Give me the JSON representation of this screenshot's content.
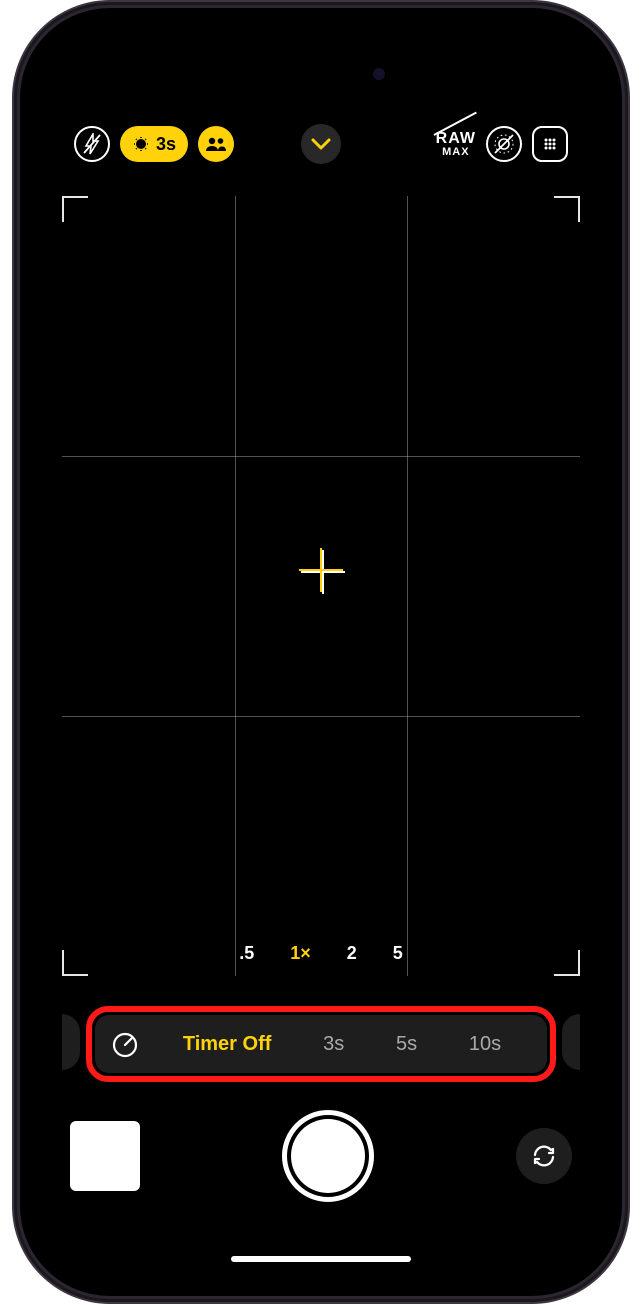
{
  "colors": {
    "accent_yellow": "#ffd20a",
    "highlight_red": "#ff1a1a"
  },
  "topbar": {
    "flash_icon": "flash-off-icon",
    "timer_badge": "3s",
    "people_icon": "people-icon",
    "chevron_icon": "chevron-down-icon",
    "raw_top": "RAW",
    "raw_sub": "MAX",
    "live_off_icon": "live-photo-off-icon",
    "photographic_styles_icon": "photographic-styles-icon"
  },
  "viewfinder": {
    "grid": true,
    "crosshair": true
  },
  "zoom": {
    "options": [
      ".5",
      "1×",
      "2",
      "5"
    ],
    "active_index": 1
  },
  "timer_bar": {
    "icon": "timer-icon",
    "options": [
      "Timer Off",
      "3s",
      "5s",
      "10s"
    ],
    "active_index": 0
  },
  "bottom": {
    "thumbnail": "last-photo-thumbnail",
    "shutter": "shutter-button",
    "flip": "camera-flip-icon"
  }
}
